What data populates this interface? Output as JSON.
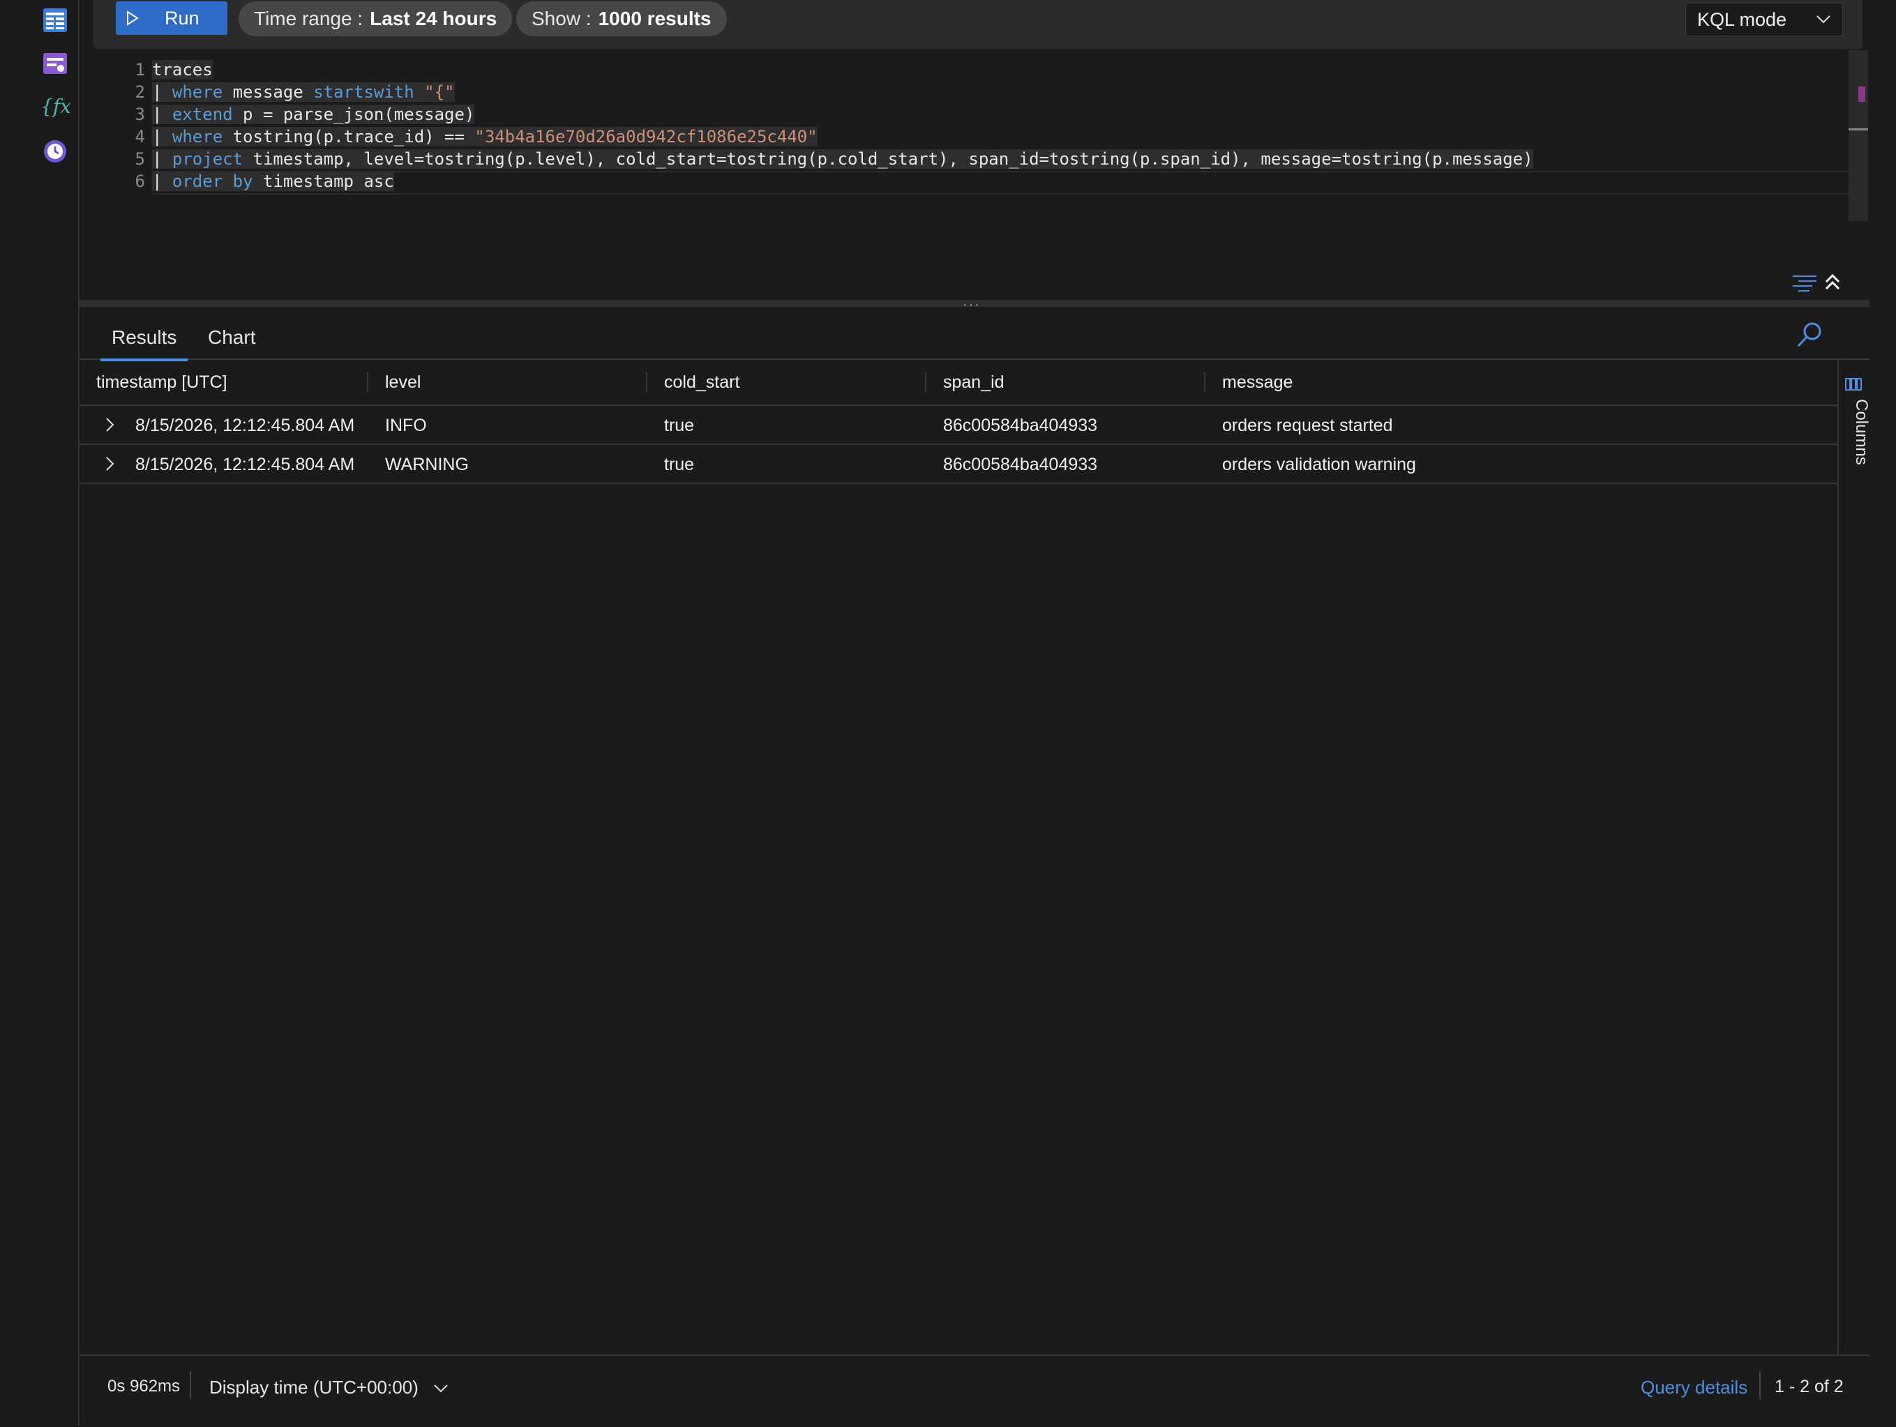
{
  "sidebar": {
    "icons": [
      "tables-icon",
      "queries-icon",
      "functions-icon",
      "query-history-icon"
    ],
    "functions_glyph": "{fx}"
  },
  "toolbar": {
    "run_label": "Run",
    "time_range_label": "Time range :",
    "time_range_value": "Last 24 hours",
    "show_label": "Show :",
    "show_value": "1000 results",
    "mode_label": "KQL mode"
  },
  "editor": {
    "line_numbers": [
      "1",
      "2",
      "3",
      "4",
      "5",
      "6"
    ],
    "lines": [
      [
        {
          "t": "traces",
          "c": ""
        }
      ],
      [
        {
          "t": "| ",
          "c": ""
        },
        {
          "t": "where",
          "c": "kw"
        },
        {
          "t": " message ",
          "c": ""
        },
        {
          "t": "startswith",
          "c": "kw"
        },
        {
          "t": " ",
          "c": ""
        },
        {
          "t": "\"{\"",
          "c": "str"
        }
      ],
      [
        {
          "t": "| ",
          "c": ""
        },
        {
          "t": "extend",
          "c": "kw"
        },
        {
          "t": " p = parse_json(message)",
          "c": ""
        }
      ],
      [
        {
          "t": "| ",
          "c": ""
        },
        {
          "t": "where",
          "c": "kw"
        },
        {
          "t": " tostring(p.trace_id) == ",
          "c": ""
        },
        {
          "t": "\"34b4a16e70d26a0d942cf1086e25c440\"",
          "c": "str"
        }
      ],
      [
        {
          "t": "| ",
          "c": ""
        },
        {
          "t": "project",
          "c": "kw"
        },
        {
          "t": " timestamp, level=tostring(p.level), cold_start=tostring(p.cold_start), span_id=tostring(p.span_id), message=tostring(p.message)",
          "c": ""
        }
      ],
      [
        {
          "t": "| ",
          "c": ""
        },
        {
          "t": "order by",
          "c": "kw"
        },
        {
          "t": " timestamp asc",
          "c": ""
        }
      ]
    ]
  },
  "results": {
    "tabs": [
      "Results",
      "Chart"
    ],
    "active_tab": "Results",
    "columns": [
      "timestamp [UTC]",
      "level",
      "cold_start",
      "span_id",
      "message"
    ],
    "rows": [
      [
        "8/15/2026, 12:12:45.804 AM",
        "INFO",
        "true",
        "86c00584ba404933",
        "orders request started"
      ],
      [
        "8/15/2026, 12:12:45.804 AM",
        "WARNING",
        "true",
        "86c00584ba404933",
        "orders validation warning"
      ]
    ],
    "columns_panel_label": "Columns"
  },
  "footer": {
    "duration": "0s 962ms",
    "display_time": "Display time (UTC+00:00)",
    "query_details": "Query details",
    "range": "1 - 2 of 2"
  },
  "colors": {
    "accent": "#2d6cc8",
    "link": "#4a90e2",
    "keyword": "#569cd6",
    "string": "#ce9178"
  }
}
